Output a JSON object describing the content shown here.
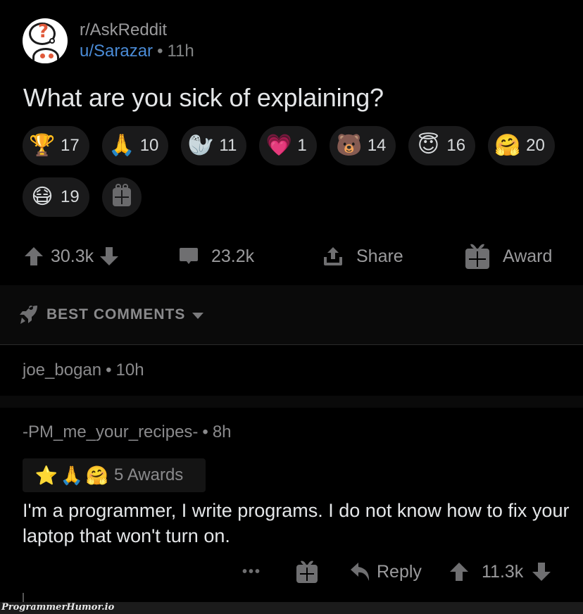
{
  "post": {
    "subreddit": "r/AskReddit",
    "author": "u/Sarazar",
    "separator": "•",
    "age": "11h",
    "title": "What are you sick of explaining?",
    "awards": [
      {
        "icon": "gold-snoo-award-icon",
        "glyph": "🏆",
        "count": "17"
      },
      {
        "icon": "clapping-hands-award-icon",
        "glyph": "🙏",
        "count": "10"
      },
      {
        "icon": "wholesome-seal-award-icon",
        "glyph": "🦭",
        "count": "11"
      },
      {
        "icon": "heart-eyes-award-icon",
        "glyph": "💗",
        "count": "1"
      },
      {
        "icon": "bear-award-icon",
        "glyph": "🐻",
        "count": "14"
      },
      {
        "icon": "angel-award-icon",
        "glyph": "😇",
        "count": "16"
      },
      {
        "icon": "wholesome-snoo-award-icon",
        "glyph": "🤗",
        "count": "20"
      },
      {
        "icon": "heart-mask-snoo-award-icon",
        "glyph": "😷",
        "count": "19"
      }
    ],
    "actions": {
      "score": "30.3k",
      "comments": "23.2k",
      "share_label": "Share",
      "award_label": "Award"
    }
  },
  "comments_header": {
    "sort_label": "BEST COMMENTS"
  },
  "comments": [
    {
      "author": "joe_bogan",
      "separator": "•",
      "age": "10h"
    },
    {
      "author": "-PM_me_your_recipes-",
      "separator": "•",
      "age": "8h",
      "awards": [
        {
          "icon": "gold-star-award-icon",
          "glyph": "⭐"
        },
        {
          "icon": "clapping-hands-award-icon",
          "glyph": "🙏"
        },
        {
          "icon": "wholesome-snoo-award-icon",
          "glyph": "🤗"
        }
      ],
      "awards_label": "5 Awards",
      "body": "I'm a programmer, I write programs. I do not know how to fix your laptop that won't turn on.",
      "actions": {
        "more_label": "•••",
        "reply_label": "Reply",
        "score": "11.3k"
      }
    }
  ],
  "watermark": "ProgrammerHumor.io",
  "colors": {
    "background": "#000000",
    "username_link": "#4a8bd6",
    "pill_bg": "#1a1a1b",
    "icon_gray": "#6f6f71"
  }
}
